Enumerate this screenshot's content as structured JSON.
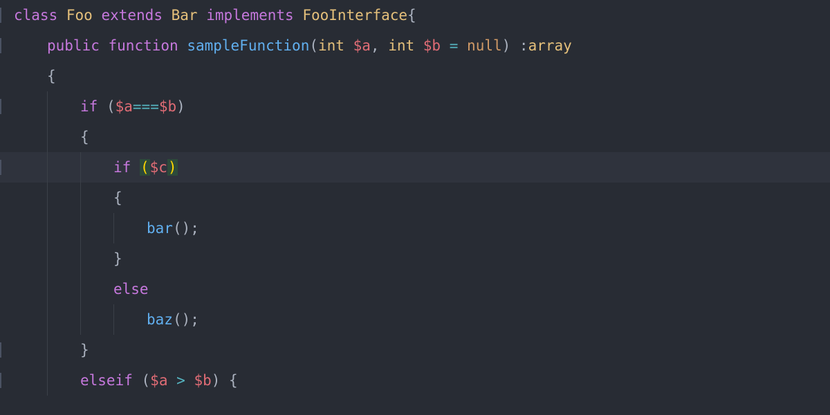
{
  "indentUnit": 48,
  "baseIndentPx": 20,
  "lines": [
    {
      "hl": false,
      "tick": true,
      "indent": 0,
      "guides": [],
      "tokens": [
        {
          "cls": "kw",
          "text": "class"
        },
        {
          "cls": "tok",
          "text": " "
        },
        {
          "cls": "cls",
          "text": "Foo"
        },
        {
          "cls": "tok",
          "text": " "
        },
        {
          "cls": "kw",
          "text": "extends"
        },
        {
          "cls": "tok",
          "text": " "
        },
        {
          "cls": "cls",
          "text": "Bar"
        },
        {
          "cls": "tok",
          "text": " "
        },
        {
          "cls": "kw",
          "text": "implements"
        },
        {
          "cls": "tok",
          "text": " "
        },
        {
          "cls": "cls",
          "text": "FooInterface"
        },
        {
          "cls": "punct",
          "text": "{"
        }
      ]
    },
    {
      "hl": false,
      "tick": true,
      "indent": 1,
      "guides": [],
      "tokens": [
        {
          "cls": "kw",
          "text": "public"
        },
        {
          "cls": "tok",
          "text": " "
        },
        {
          "cls": "kw",
          "text": "function"
        },
        {
          "cls": "tok",
          "text": " "
        },
        {
          "cls": "fn",
          "text": "sampleFunction"
        },
        {
          "cls": "punct",
          "text": "("
        },
        {
          "cls": "type",
          "text": "int"
        },
        {
          "cls": "tok",
          "text": " "
        },
        {
          "cls": "var",
          "text": "$a"
        },
        {
          "cls": "punct",
          "text": ", "
        },
        {
          "cls": "type",
          "text": "int"
        },
        {
          "cls": "tok",
          "text": " "
        },
        {
          "cls": "var",
          "text": "$b"
        },
        {
          "cls": "tok",
          "text": " "
        },
        {
          "cls": "op",
          "text": "="
        },
        {
          "cls": "tok",
          "text": " "
        },
        {
          "cls": "num-null",
          "text": "null"
        },
        {
          "cls": "punct",
          "text": ") :"
        },
        {
          "cls": "type",
          "text": "array"
        }
      ]
    },
    {
      "hl": false,
      "tick": false,
      "indent": 1,
      "guides": [],
      "tokens": [
        {
          "cls": "punct",
          "text": "{"
        }
      ]
    },
    {
      "hl": false,
      "tick": true,
      "indent": 2,
      "guides": [
        1
      ],
      "tokens": [
        {
          "cls": "if-kw",
          "text": "if"
        },
        {
          "cls": "tok",
          "text": " "
        },
        {
          "cls": "punct",
          "text": "("
        },
        {
          "cls": "var",
          "text": "$a"
        },
        {
          "cls": "op",
          "text": "==="
        },
        {
          "cls": "var",
          "text": "$b"
        },
        {
          "cls": "punct",
          "text": ")"
        }
      ]
    },
    {
      "hl": false,
      "tick": false,
      "indent": 2,
      "guides": [
        1
      ],
      "tokens": [
        {
          "cls": "punct",
          "text": "{"
        }
      ]
    },
    {
      "hl": true,
      "tick": true,
      "indent": 3,
      "guides": [
        1,
        2
      ],
      "tokens": [
        {
          "cls": "if-kw",
          "text": "if"
        },
        {
          "cls": "tok",
          "text": " "
        },
        {
          "cls": "match-paren-green",
          "text": "("
        },
        {
          "cls": "cursor-var",
          "text": "$c"
        },
        {
          "cls": "match-paren-green",
          "text": ")"
        }
      ]
    },
    {
      "hl": false,
      "tick": false,
      "indent": 3,
      "guides": [
        1,
        2
      ],
      "tokens": [
        {
          "cls": "punct",
          "text": "{"
        }
      ]
    },
    {
      "hl": false,
      "tick": false,
      "indent": 4,
      "guides": [
        1,
        2,
        3
      ],
      "tokens": [
        {
          "cls": "fn",
          "text": "bar"
        },
        {
          "cls": "punct",
          "text": "();"
        }
      ]
    },
    {
      "hl": false,
      "tick": false,
      "indent": 3,
      "guides": [
        1,
        2
      ],
      "tokens": [
        {
          "cls": "punct",
          "text": "}"
        }
      ]
    },
    {
      "hl": false,
      "tick": false,
      "indent": 3,
      "guides": [
        1,
        2
      ],
      "tokens": [
        {
          "cls": "else-kw",
          "text": "else"
        }
      ]
    },
    {
      "hl": false,
      "tick": false,
      "indent": 4,
      "guides": [
        1,
        2,
        3
      ],
      "tokens": [
        {
          "cls": "fn",
          "text": "baz"
        },
        {
          "cls": "punct",
          "text": "();"
        }
      ]
    },
    {
      "hl": false,
      "tick": true,
      "indent": 2,
      "guides": [
        1
      ],
      "tokens": [
        {
          "cls": "punct",
          "text": "}"
        }
      ]
    },
    {
      "hl": false,
      "tick": true,
      "indent": 2,
      "guides": [
        1
      ],
      "tokens": [
        {
          "cls": "if-kw",
          "text": "elseif"
        },
        {
          "cls": "tok",
          "text": " "
        },
        {
          "cls": "punct",
          "text": "("
        },
        {
          "cls": "var",
          "text": "$a"
        },
        {
          "cls": "tok",
          "text": " "
        },
        {
          "cls": "op",
          "text": ">"
        },
        {
          "cls": "tok",
          "text": " "
        },
        {
          "cls": "var",
          "text": "$b"
        },
        {
          "cls": "punct",
          "text": ") {"
        }
      ]
    }
  ]
}
